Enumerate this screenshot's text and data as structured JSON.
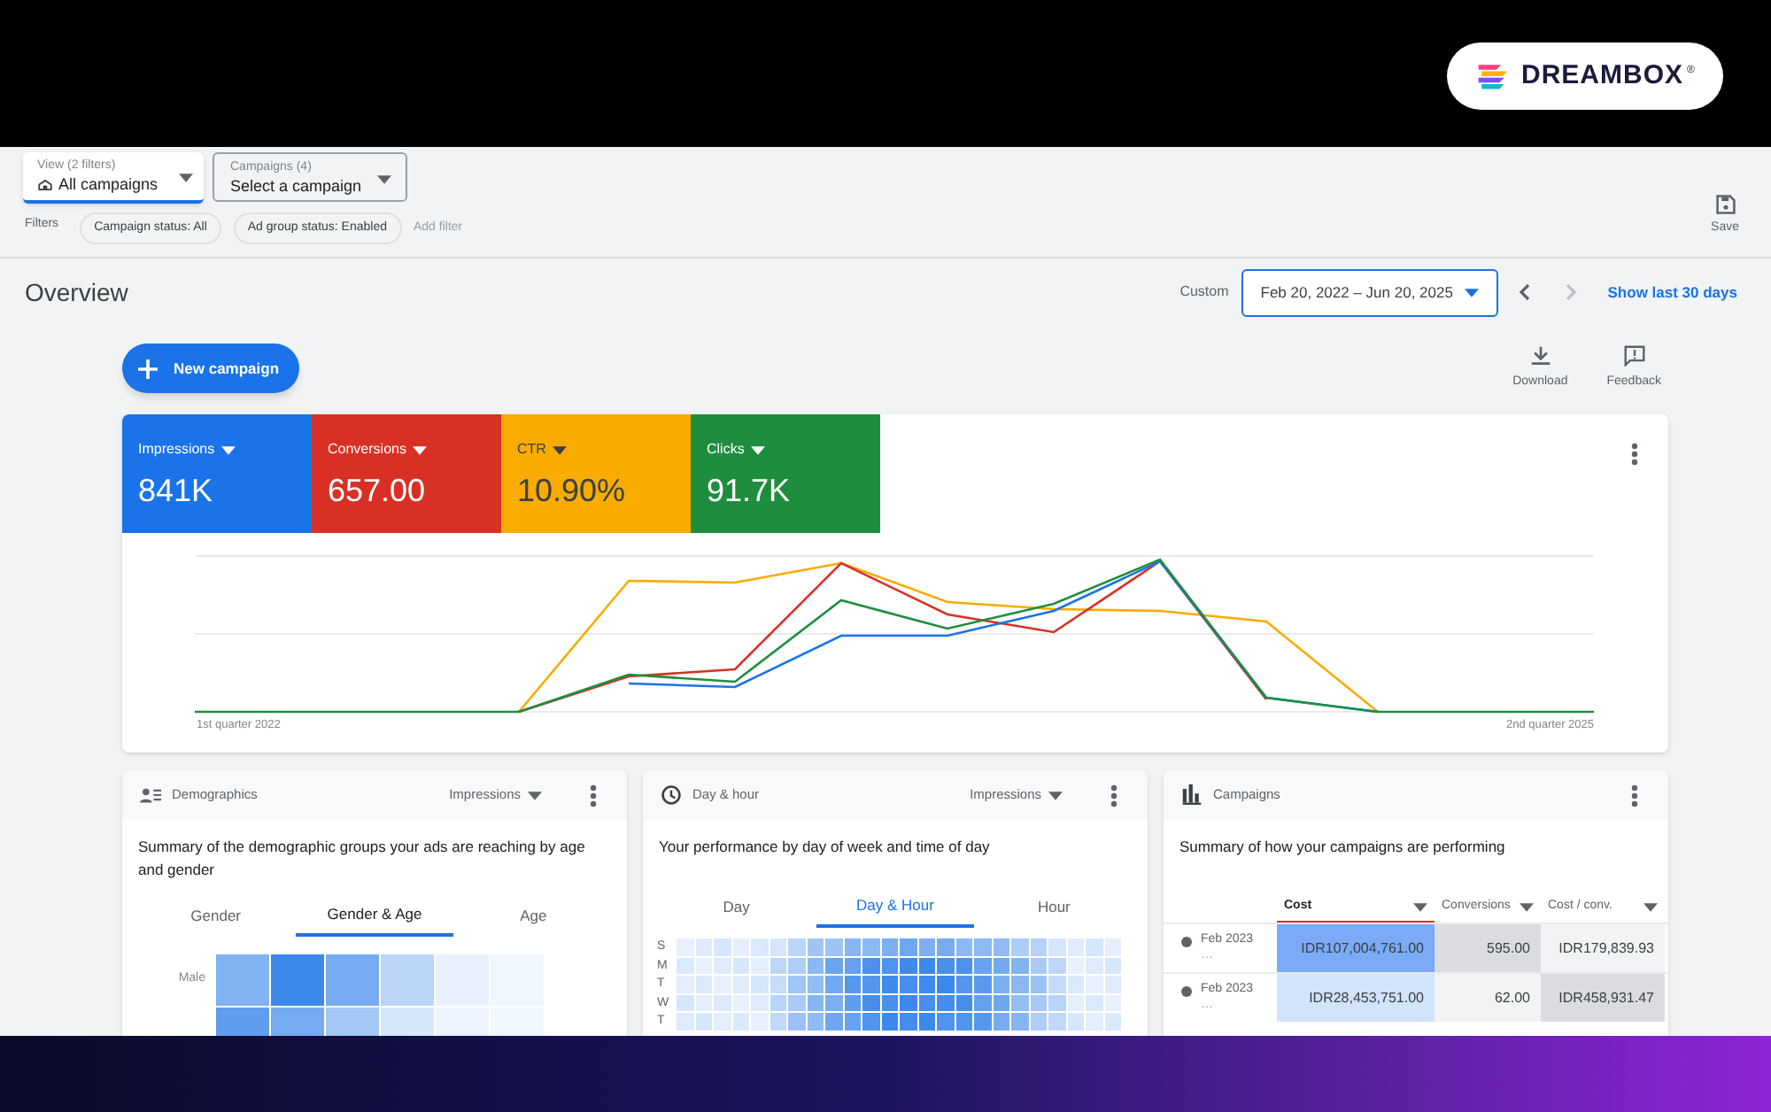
{
  "brand": {
    "name": "DREAMBOX",
    "mark": "®"
  },
  "view_select": {
    "label": "View (2 filters)",
    "value": "All campaigns"
  },
  "campaign_select": {
    "label": "Campaigns (4)",
    "value": "Select a campaign"
  },
  "filters": {
    "label": "Filters",
    "chips": [
      "Campaign status: All",
      "Ad group status: Enabled"
    ],
    "add": "Add filter"
  },
  "save": "Save",
  "title": "Overview",
  "date_range": {
    "label": "Custom",
    "value": "Feb 20, 2022 – Jun 20, 2025",
    "link": "Show last 30 days"
  },
  "new_campaign": "New campaign",
  "actions": [
    {
      "kind": "download",
      "label": "Download"
    },
    {
      "kind": "feedback",
      "label": "Feedback"
    }
  ],
  "metrics": [
    {
      "label": "Impressions",
      "value": "841K",
      "color": "#1a73e8"
    },
    {
      "label": "Conversions",
      "value": "657.00",
      "color": "#d93025"
    },
    {
      "label": "CTR",
      "value": "10.90%",
      "color": "#f9ab00"
    },
    {
      "label": "Clicks",
      "value": "91.7K",
      "color": "#1e8e3e"
    }
  ],
  "chart": {
    "x_start": "1st quarter 2022",
    "x_end": "2nd quarter 2025"
  },
  "panels": [
    {
      "kind": "demographics",
      "title": "Demographics",
      "metric": "Impressions",
      "description": "Summary of the demographic groups your ads are reaching by age and gender",
      "tabs": [
        {
          "label": "Gender",
          "selected": false
        },
        {
          "label": "Gender & Age",
          "selected": true
        },
        {
          "label": "Age",
          "selected": false
        }
      ],
      "rows": [
        "Male"
      ]
    },
    {
      "kind": "day_hour",
      "title": "Day & hour",
      "metric": "Impressions",
      "description": "Your performance by day of week and time of day",
      "tabs": [
        {
          "label": "Day",
          "selected": false
        },
        {
          "label": "Day & Hour",
          "selected": true
        },
        {
          "label": "Hour",
          "selected": false
        }
      ],
      "rows": [
        "S",
        "M",
        "T",
        "W",
        "T"
      ]
    },
    {
      "kind": "campaigns",
      "title": "Campaigns",
      "description": "Summary of how your campaigns are performing",
      "columns": [
        "Cost",
        "Conversions",
        "Cost / conv."
      ],
      "rows": [
        {
          "name": "Feb 2023",
          "sub": "…",
          "cells": [
            {
              "value": "IDR107,004,761.00",
              "color": "#7baaf7"
            },
            {
              "value": "595.00",
              "color": "#dadce0"
            },
            {
              "value": "IDR179,839.93",
              "color": "#f1f3f4"
            }
          ]
        },
        {
          "name": "Feb 2023",
          "sub": "…",
          "cells": [
            {
              "value": "IDR28,453,751.00",
              "color": "#d2e3fc"
            },
            {
              "value": "62.00",
              "color": "#f1f3f4"
            },
            {
              "value": "IDR458,931.47",
              "color": "#dadce0"
            }
          ]
        }
      ]
    }
  ]
}
